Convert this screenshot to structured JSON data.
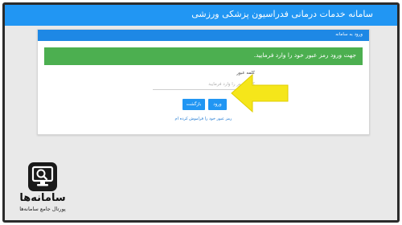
{
  "app": {
    "title": "سامانه خدمات درمانی فدراسیون پزشکی ورزشی"
  },
  "login_panel": {
    "header_title": "ورود به سامانه",
    "alert_message": "جهت ورود رمز عبور خود را وارد فرمایید.",
    "password_label": "کلمه عبور",
    "password_placeholder": "کلمه عبور را وارد فرمایید",
    "password_value": "",
    "login_button": "ورود",
    "back_button": "بازگشت",
    "forgot_link": "رمز عبور خود را فراموش کرده ام"
  },
  "watermark": {
    "name": "سامانه‌ها",
    "tagline": "پورتال جامع سامانه‌ها"
  },
  "colors": {
    "header_blue": "#2196f3",
    "alert_green": "#4caf50",
    "arrow_yellow": "#f5e61a"
  },
  "icons": {
    "pointer_arrow": "yellow-arrow-icon",
    "logo": "search-screen-icon"
  }
}
